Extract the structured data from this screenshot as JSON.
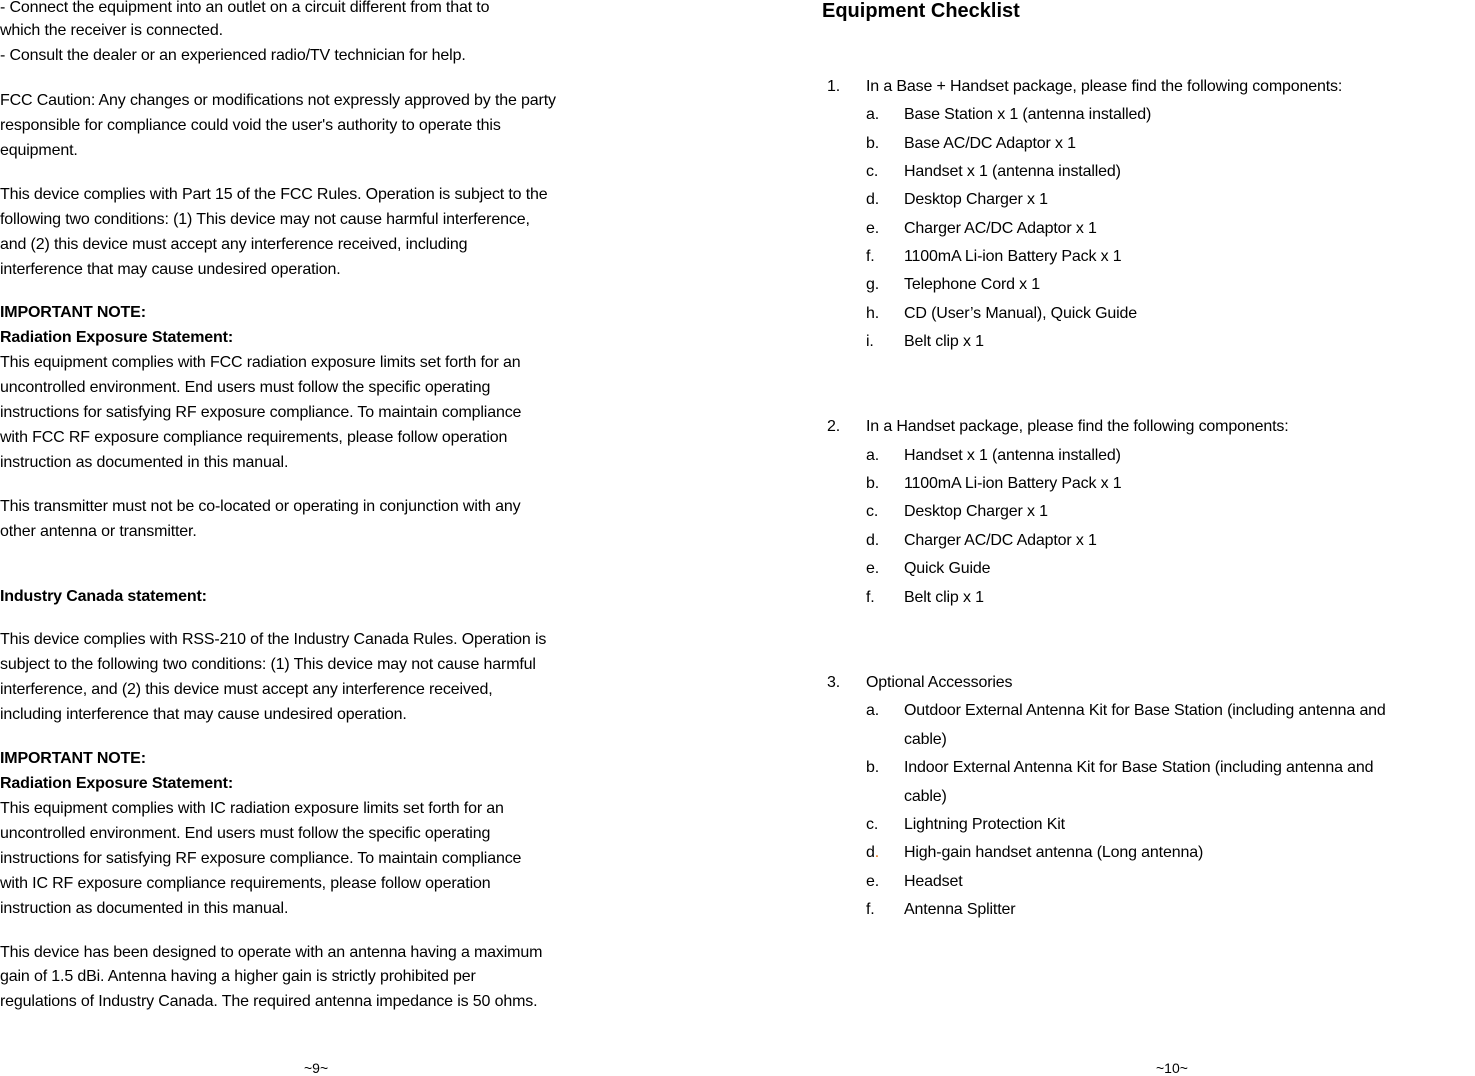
{
  "left_page": {
    "lines": [
      {
        "text": "-  Connect the equipment into an outlet on a circuit different from that to"
      },
      {
        "text": "    which the receiver is connected."
      },
      {
        "text": "-  Consult the dealer or an experienced radio/TV technician for help."
      },
      {
        "text": "FCC Caution: Any changes or modifications not expressly approved by the party"
      },
      {
        "text": "responsible for compliance could void the user's authority to operate this"
      },
      {
        "text": "equipment."
      },
      {
        "text": "This device complies with Part 15 of the FCC Rules. Operation is subject to the"
      },
      {
        "text": "following two conditions: (1) This device may not cause harmful interference,"
      },
      {
        "text": "and (2) this device must accept any interference received, including"
      },
      {
        "text": "interference that may cause undesired operation."
      },
      {
        "text": "IMPORTANT NOTE:",
        "bold": true
      },
      {
        "text": "Radiation Exposure Statement:",
        "bold": true
      },
      {
        "text": "This equipment complies with FCC radiation exposure limits set forth for an"
      },
      {
        "text": "uncontrolled environment. End users must follow the specific operating"
      },
      {
        "text": "instructions for satisfying RF exposure compliance. To maintain compliance"
      },
      {
        "text": "with FCC RF exposure compliance requirements, please follow operation"
      },
      {
        "text": "instruction as documented in this manual."
      },
      {
        "text": "This transmitter must not be co-located or operating in conjunction with any"
      },
      {
        "text": "other antenna or transmitter."
      },
      {
        "text": "Industry Canada statement:",
        "bold": true
      },
      {
        "text": "This device complies with RSS-210 of the Industry Canada Rules. Operation is"
      },
      {
        "text": "subject to the following two conditions: (1) This device may not cause harmful"
      },
      {
        "text": "interference, and (2) this device must accept any interference received,"
      },
      {
        "text": "including interference that may cause undesired operation."
      },
      {
        "text": "IMPORTANT NOTE:",
        "bold": true
      },
      {
        "text": "Radiation Exposure Statement:",
        "bold": true
      },
      {
        "text": "This equipment complies with IC radiation exposure limits set forth for an"
      },
      {
        "text": "uncontrolled environment. End users must follow the specific operating"
      },
      {
        "text": "instructions for satisfying RF exposure compliance. To maintain compliance"
      },
      {
        "text": "with IC RF exposure compliance requirements, please follow operation"
      },
      {
        "text": "instruction as documented in this manual."
      },
      {
        "text": "This device has been designed to operate with an antenna having a maximum"
      },
      {
        "text": "gain of 1.5 dBi.  Antenna having a higher gain is strictly prohibited per"
      },
      {
        "text": "regulations of Industry Canada. The required antenna impedance is 50 ohms."
      }
    ],
    "page_number": "~9~"
  },
  "right_page": {
    "title": "Equipment Checklist",
    "sections": [
      {
        "number": "1.",
        "text": "In a Base + Handset package, please find the following components:",
        "items": [
          {
            "letter": "a.",
            "text": "Base Station x 1 (antenna installed)"
          },
          {
            "letter": "b.",
            "text": "Base AC/DC Adaptor x 1"
          },
          {
            "letter": "c.",
            "text": "Handset x 1 (antenna installed)"
          },
          {
            "letter": "d.",
            "text": "Desktop Charger x 1"
          },
          {
            "letter": "e.",
            "text": "Charger AC/DC Adaptor x 1"
          },
          {
            "letter": "f.",
            "text": "1100mA Li-ion Battery Pack x 1"
          },
          {
            "letter": "g.",
            "text": "Telephone Cord x 1"
          },
          {
            "letter": "h.",
            "text": "CD (User’s Manual), Quick Guide"
          },
          {
            "letter": "i.",
            "text": "Belt clip x 1"
          }
        ]
      },
      {
        "number": "2.",
        "text": "In a Handset package, please find the following components:",
        "items": [
          {
            "letter": "a.",
            "text": "Handset x 1 (antenna installed)"
          },
          {
            "letter": "b.",
            "text": "1100mA Li-ion Battery Pack x 1"
          },
          {
            "letter": "c.",
            "text": "Desktop Charger x 1"
          },
          {
            "letter": "d.",
            "text": "Charger AC/DC Adaptor x 1"
          },
          {
            "letter": "e.",
            "text": "Quick Guide"
          },
          {
            "letter": "f.",
            "text": "Belt clip x 1"
          }
        ]
      },
      {
        "number": "3.",
        "text": "Optional Accessories",
        "items": [
          {
            "letter": "a.",
            "text": "Outdoor External Antenna Kit for Base Station (including antenna and",
            "cont": "cable)"
          },
          {
            "letter": "b.",
            "text": "Indoor External Antenna Kit for Base Station (including antenna and",
            "cont": "cable)"
          },
          {
            "letter": "c.",
            "text": "Lightning Protection Kit"
          },
          {
            "letter": "d",
            "dot": ".",
            "text": "High-gain handset antenna (Long antenna)"
          },
          {
            "letter": "e.",
            "text": "Headset"
          },
          {
            "letter": "f.",
            "text": "Antenna Splitter"
          }
        ]
      }
    ],
    "accent_dot_color": "#e36c0a",
    "page_number": "~10~"
  }
}
